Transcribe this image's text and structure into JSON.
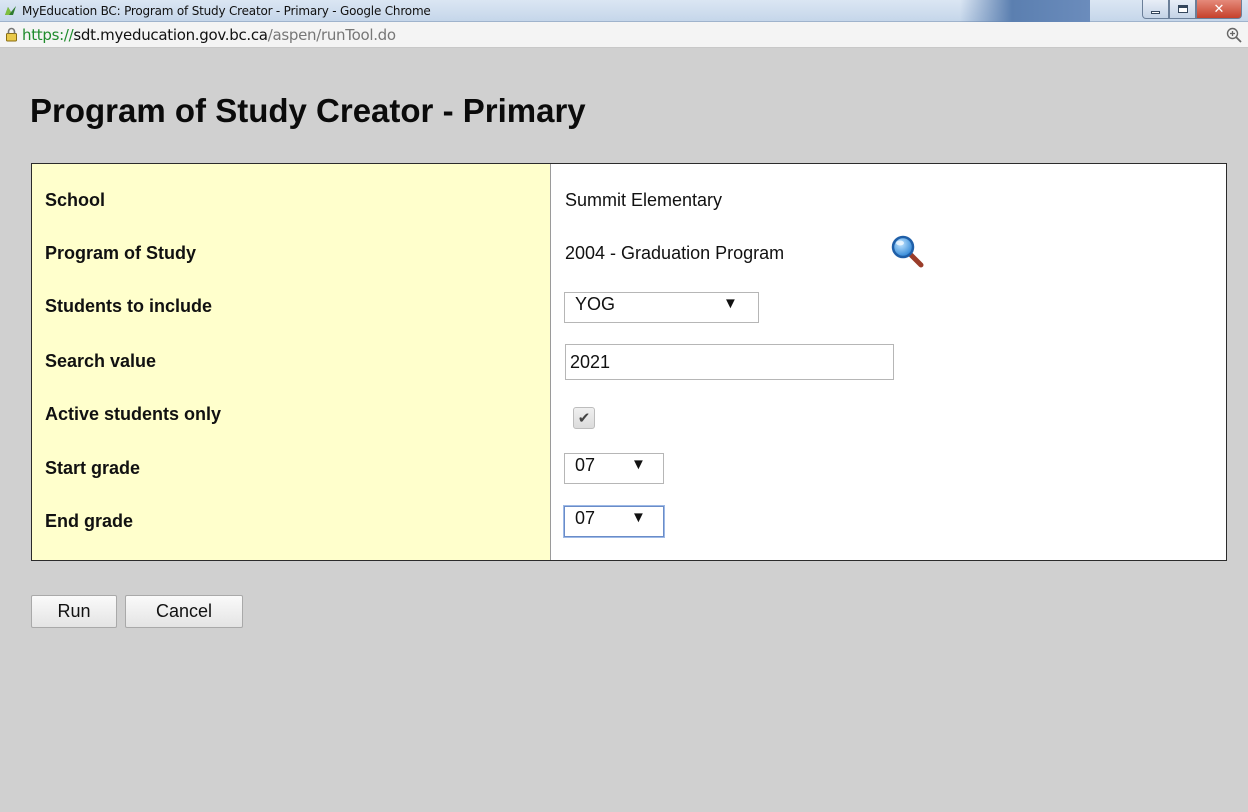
{
  "window": {
    "title": "MyEducation BC: Program of Study Creator - Primary - Google Chrome"
  },
  "address_bar": {
    "scheme": "https://",
    "host": "sdt.myeducation.gov.bc.ca",
    "path": "/aspen/runTool.do"
  },
  "page": {
    "title": "Program of Study Creator - Primary"
  },
  "form": {
    "school": {
      "label": "School",
      "value": "Summit Elementary"
    },
    "program": {
      "label": "Program of Study",
      "value": "2004 - Graduation Program",
      "icon": "search-icon"
    },
    "students": {
      "label": "Students to include",
      "selected": "YOG"
    },
    "search": {
      "label": "Search value",
      "value": "2021"
    },
    "active": {
      "label": "Active students only",
      "checked": true
    },
    "start_grade": {
      "label": "Start grade",
      "selected": "07"
    },
    "end_grade": {
      "label": "End grade",
      "selected": "07"
    }
  },
  "actions": {
    "run_label": "Run",
    "cancel_label": "Cancel"
  },
  "colors": {
    "label_column_bg": "#ffffcc",
    "page_bg": "#d0d0d0",
    "url_scheme": "#1f8b2c"
  }
}
